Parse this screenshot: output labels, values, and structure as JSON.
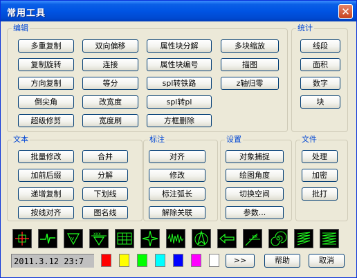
{
  "window": {
    "title": "常用工具",
    "close_label": "✕"
  },
  "groups": {
    "edit": "编辑",
    "stats": "统计",
    "text": "文本",
    "dim": "标注",
    "settings": "设置",
    "file": "文件"
  },
  "edit_buttons": [
    "多重复制",
    "双向偏移",
    "属性块分解",
    "多块缩放",
    "复制旋转",
    "连接",
    "属性块编号",
    "描图",
    "方向复制",
    "等分",
    "spl转铁路",
    "z轴归零",
    "倒尖角",
    "改宽度",
    "spl转pl",
    "超级修剪",
    "宽度刷",
    "方框删除"
  ],
  "stats_buttons": [
    "线段",
    "面积",
    "数字",
    "块"
  ],
  "text_buttons": [
    "批量修改",
    "合并",
    "加前后缀",
    "分解",
    "递增复制",
    "下划线",
    "按线对齐",
    "图名线"
  ],
  "dim_buttons": [
    "对齐",
    "修改",
    "标注弧长",
    "解除关联"
  ],
  "settings_buttons": [
    "对象捕捉",
    "绘图角度",
    "切换空间",
    "参数..."
  ],
  "file_buttons": [
    "处理",
    "加密",
    "批打"
  ],
  "icons": [
    "crosshair-icon",
    "break-line-icon",
    "triangle-v-icon",
    "triangle-xxx-icon",
    "grid-icon",
    "star-icon",
    "wave-icon",
    "north-arrow-icon",
    "arrow-left-icon",
    "leader-xx-icon",
    "spiral-icon",
    "hatch-lines-icon",
    "zigzag-lines-icon"
  ],
  "status_text": "2011.3.12  23:7",
  "colors": [
    "#ff0000",
    "#ffff00",
    "#00ff00",
    "#00ffff",
    "#0000ff",
    "#ff00ff",
    "#ffffff"
  ],
  "bottom": {
    "more_label": ">>",
    "help_label": "帮助",
    "cancel_label": "取消"
  }
}
